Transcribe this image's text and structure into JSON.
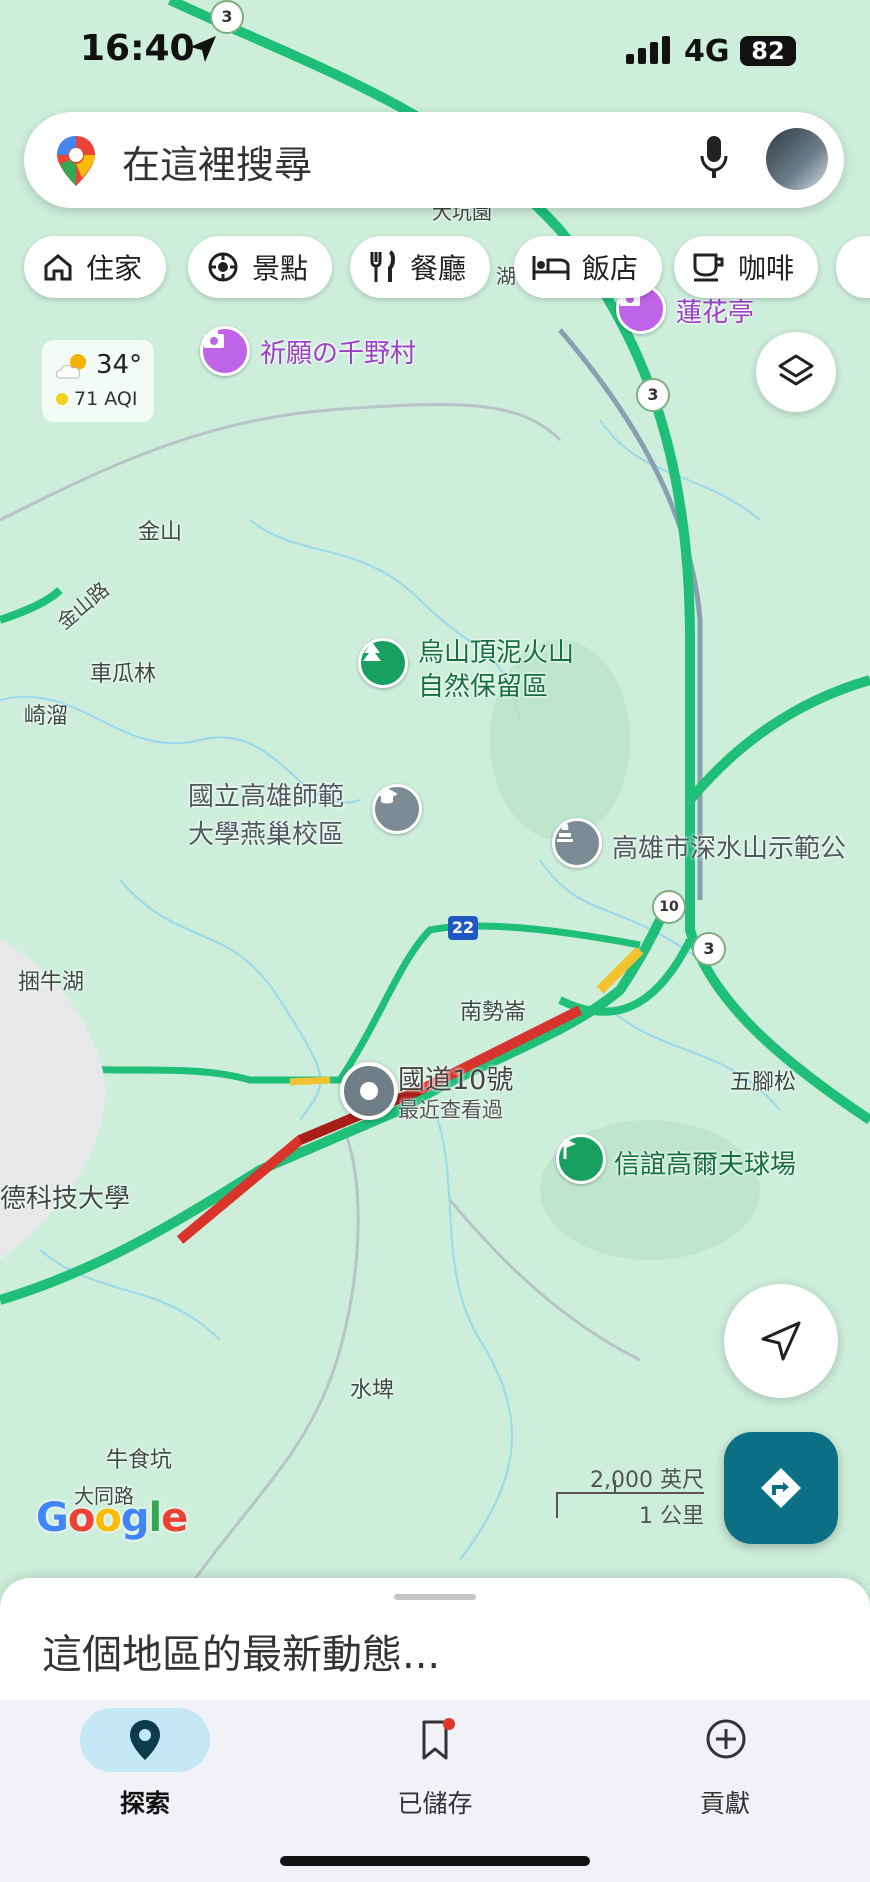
{
  "status_bar": {
    "time": "16:40",
    "network": "4G",
    "battery": "82"
  },
  "search": {
    "placeholder": "在這裡搜尋"
  },
  "chips": [
    {
      "label": "住家",
      "icon": "home-icon"
    },
    {
      "label": "景點",
      "icon": "attraction-icon"
    },
    {
      "label": "餐廳",
      "icon": "restaurant-icon"
    },
    {
      "label": "飯店",
      "icon": "hotel-icon"
    },
    {
      "label": "咖啡",
      "icon": "coffee-icon"
    }
  ],
  "weather": {
    "temperature": "34°",
    "aqi": "71 AQI"
  },
  "map": {
    "places": {
      "qiyuan": "祈願の千野村",
      "lianhua": "蓮花亭",
      "wushan_line1": "烏山頂泥火山",
      "wushan_line2": "自然保留區",
      "nknu_line1": "國立高雄師範",
      "nknu_line2": "大學燕巢校區",
      "shenshui": "高雄市深水山示範公",
      "golf": "信誼高爾夫球場",
      "recent_name": "國道10號",
      "recent_sub": "最近查看過"
    },
    "labels": {
      "jinshan": "金山",
      "jinshan_road": "金山路",
      "cheguolin": "車瓜林",
      "qiliu": "崎溜",
      "kunniuhu": "捆牛湖",
      "nanshilun": "南勢崙",
      "wujiaosong": "五腳松",
      "university": "德科技大學",
      "shuiba": "水埤",
      "niushikeng": "牛食坑",
      "datong_road": "大同路",
      "top_partial": "大坑園",
      "lake_partial": "湖"
    },
    "route_shields": {
      "r3": "3",
      "r10": "10",
      "r22": "22"
    },
    "google_logo": "Google",
    "scale": {
      "imperial": "2,000 英尺",
      "metric": "1 公里"
    }
  },
  "bottom_sheet": {
    "title": "這個地區的最新動態..."
  },
  "nav": {
    "tabs": [
      {
        "label": "探索",
        "icon": "explore-pin-icon"
      },
      {
        "label": "已儲存",
        "icon": "bookmark-icon"
      },
      {
        "label": "貢獻",
        "icon": "add-circle-icon"
      }
    ]
  },
  "colors": {
    "highway": "#1fbf7a",
    "heavy_traffic": "#d9342b",
    "slow_traffic": "#f2c230",
    "accent": "#0b6f86"
  }
}
